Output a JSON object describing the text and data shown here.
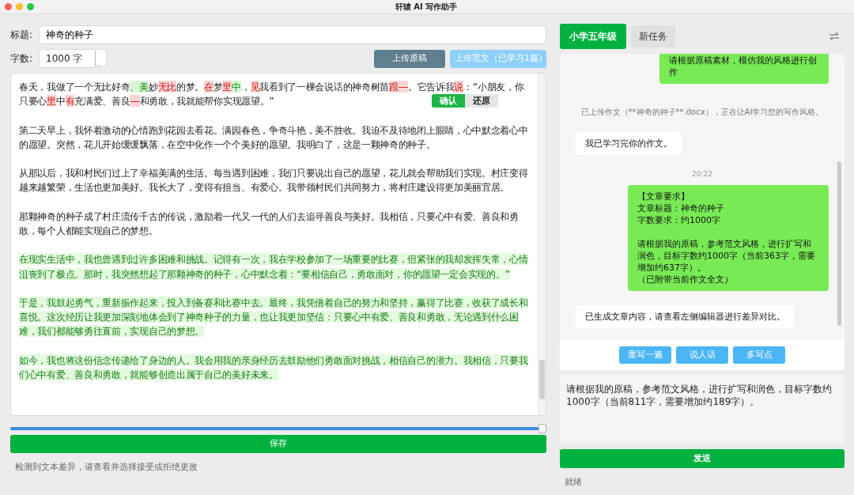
{
  "window": {
    "title": "轩辕 AI 写作助手"
  },
  "editor_form": {
    "title_label": "标题:",
    "title_value": "神奇的种子",
    "count_label": "字数:",
    "count_value": "1000 字",
    "buttons": [
      "上传原稿",
      "上传范文（已学习1篇）"
    ]
  },
  "editor": {
    "paragraphs": [
      {
        "kind": "diff",
        "segments": [
          {
            "kind": "same",
            "text": "春天，我做了一个无比好奇"
          },
          {
            "kind": "add",
            "text": "、美"
          },
          {
            "kind": "same",
            "text": "妙"
          },
          {
            "kind": "del",
            "text": "无比"
          },
          {
            "kind": "same",
            "text": "的梦。"
          },
          {
            "kind": "del",
            "text": "在"
          },
          {
            "kind": "same",
            "text": "梦"
          },
          {
            "kind": "del",
            "text": "里"
          },
          {
            "kind": "add",
            "text": "中"
          },
          {
            "kind": "same",
            "text": "，"
          },
          {
            "kind": "del",
            "text": "见"
          },
          {
            "kind": "same",
            "text": "我看到了一棵会说话的神奇树苗"
          },
          {
            "kind": "del",
            "text": "跟—"
          },
          {
            "kind": "same",
            "text": "。它告诉我"
          },
          {
            "kind": "del",
            "text": "说"
          },
          {
            "kind": "same",
            "text": "：“小朋友，你只要心"
          },
          {
            "kind": "del",
            "text": "里"
          },
          {
            "kind": "same",
            "text": "中"
          },
          {
            "kind": "del",
            "text": "有"
          },
          {
            "kind": "same",
            "text": "充满爱、善良"
          },
          {
            "kind": "del",
            "text": "—"
          },
          {
            "kind": "same",
            "text": "和勇敢，我就能帮你实现愿望。”"
          }
        ]
      },
      {
        "kind": "plain",
        "text": "第二天早上，我怀着激动的心情跑到花园去看花。满园春色，争奇斗艳，美不胜收。我迫不及待地闭上眼睛，心中默念着心中的愿望。突然，花儿开始缓缓飘落，在空中化作一个个美好的愿望。我明白了，这是一颗神奇的种子。"
      },
      {
        "kind": "plain",
        "text": "从那以后，我和村民们过上了幸福美满的生活。每当遇到困难，我们只要说出自己的愿望，花儿就会帮助我们实现。村庄变得越来越繁荣，生活也更加美好。我长大了，变得有担当、有爱心。我带领村民们共同努力，将村庄建设得更加美丽宜居。"
      },
      {
        "kind": "plain",
        "text": "那颗神奇的种子成了村庄流传千古的传说，激励着一代又一代的人们去追寻善良与美好。我相信，只要心中有爱、善良和勇敢，每个人都能实现自己的梦想。"
      },
      {
        "kind": "added",
        "text": "在现实生活中，我也曾遇到过许多困难和挑战。记得有一次，我在学校参加了一场重要的比赛，但紧张的我却发挥失常，心情沮丧到了极点。那时，我突然想起了那颗神奇的种子，心中默念着：“要相信自己，勇敢面对，你的愿望一定会实现的。”"
      },
      {
        "kind": "added",
        "text": "于是，我鼓起勇气，重新振作起来，投入到备赛和比赛中去。最终，我凭借着自己的努力和坚持，赢得了比赛，收获了成长和喜悦。这次经历让我更加深刻地体会到了神奇种子的力量，也让我更加坚信：只要心中有爱、善良和勇敢，无论遇到什么困难，我们都能够勇往直前，实现自己的梦想。"
      },
      {
        "kind": "added",
        "text": "如今，我也将这份信念传递给了身边的人。我会用我的亲身经历去鼓励他们勇敢面对挑战，相信自己的潜力。我相信，只要我们心中有爱、善良和勇敢，就能够创造出属于自己的美好未来。"
      }
    ],
    "popover": [
      "确认",
      "还原"
    ]
  },
  "slider": {
    "level": 1.0
  },
  "save_button": "保存",
  "left_status": "检测到文本差异，请查看并选择接受或拒绝更改",
  "tabs": [
    {
      "label": "小学五年级",
      "selected": true
    },
    {
      "label": "新任务",
      "selected": false
    }
  ],
  "chat": [
    {
      "kind": "user",
      "blocks": [
        [
          "请根据原稿素材，模仿我的风格进行创作"
        ]
      ]
    },
    {
      "kind": "note",
      "text": "已上传作文（**神奇的种子**.docx），正在让AI学习您的写作风格。"
    },
    {
      "kind": "bot",
      "text": "我已学习完你的作文。"
    },
    {
      "kind": "time",
      "text": "20:22"
    },
    {
      "kind": "user",
      "blocks": [
        [
          "【文章要求】",
          "文章标题：神奇的种子",
          "字数要求：约1000字"
        ],
        [
          "请根据我的原稿，参考范文风格，进行扩写和润色，目标字数约1000字（当前363字，需要增加约637字）。",
          "（已附带当前作文全文）"
        ]
      ]
    },
    {
      "kind": "bot",
      "text": "已生成文章内容，请查看左侧编辑器进行差异对比。"
    }
  ],
  "quick_buttons": [
    "重写一遍",
    "说人话",
    "多写点"
  ],
  "message_input": {
    "value": "请根据我的原稿，参考范文风格，进行扩写和润色，目标字数约1000字（当前811字，需要增加约189字）。"
  },
  "send_button": "发送",
  "right_status": "就绪"
}
